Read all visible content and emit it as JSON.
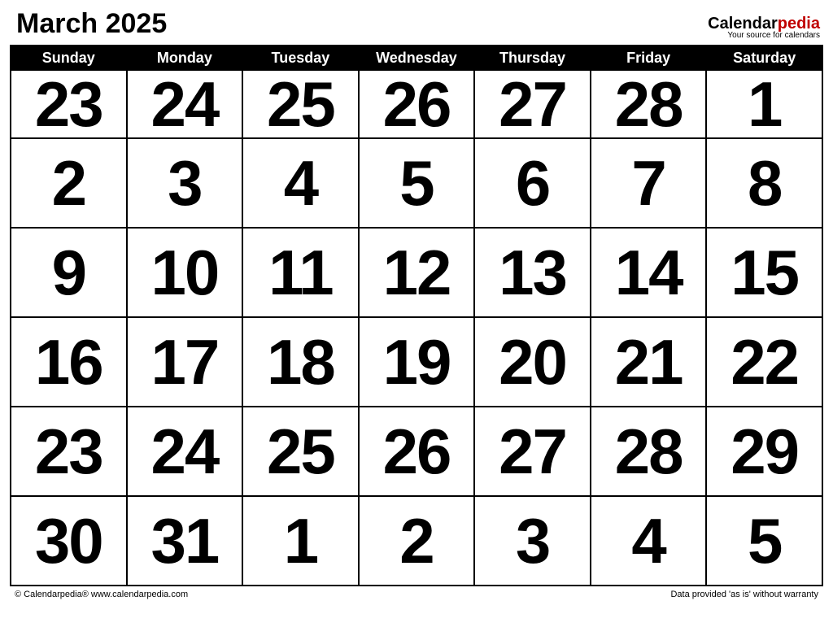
{
  "title": "March 2025",
  "brand": {
    "name_part1": "Calendar",
    "name_part2": "pedia",
    "tagline": "Your source for calendars"
  },
  "days": {
    "sun": "Sunday",
    "mon": "Monday",
    "tue": "Tuesday",
    "wed": "Wednesday",
    "thu": "Thursday",
    "fri": "Friday",
    "sat": "Saturday"
  },
  "weeks": [
    [
      {
        "n": "23",
        "type": "other"
      },
      {
        "n": "24",
        "type": "other"
      },
      {
        "n": "25",
        "type": "other"
      },
      {
        "n": "26",
        "type": "other"
      },
      {
        "n": "27",
        "type": "other"
      },
      {
        "n": "28",
        "type": "other"
      },
      {
        "n": "1",
        "type": "sat"
      }
    ],
    [
      {
        "n": "2",
        "type": "sun"
      },
      {
        "n": "3",
        "type": "wk"
      },
      {
        "n": "4",
        "type": "wk"
      },
      {
        "n": "5",
        "type": "wk"
      },
      {
        "n": "6",
        "type": "wk"
      },
      {
        "n": "7",
        "type": "wk"
      },
      {
        "n": "8",
        "type": "sat"
      }
    ],
    [
      {
        "n": "9",
        "type": "sun"
      },
      {
        "n": "10",
        "type": "wk"
      },
      {
        "n": "11",
        "type": "wk"
      },
      {
        "n": "12",
        "type": "wk"
      },
      {
        "n": "13",
        "type": "wk"
      },
      {
        "n": "14",
        "type": "wk"
      },
      {
        "n": "15",
        "type": "sat"
      }
    ],
    [
      {
        "n": "16",
        "type": "sun"
      },
      {
        "n": "17",
        "type": "wk"
      },
      {
        "n": "18",
        "type": "wk"
      },
      {
        "n": "19",
        "type": "wk"
      },
      {
        "n": "20",
        "type": "wk"
      },
      {
        "n": "21",
        "type": "wk"
      },
      {
        "n": "22",
        "type": "sat"
      }
    ],
    [
      {
        "n": "23",
        "type": "sun"
      },
      {
        "n": "24",
        "type": "wk"
      },
      {
        "n": "25",
        "type": "wk"
      },
      {
        "n": "26",
        "type": "wk"
      },
      {
        "n": "27",
        "type": "wk"
      },
      {
        "n": "28",
        "type": "wk"
      },
      {
        "n": "29",
        "type": "sat"
      }
    ],
    [
      {
        "n": "30",
        "type": "sun"
      },
      {
        "n": "31",
        "type": "wk"
      },
      {
        "n": "1",
        "type": "other"
      },
      {
        "n": "2",
        "type": "other"
      },
      {
        "n": "3",
        "type": "other"
      },
      {
        "n": "4",
        "type": "other"
      },
      {
        "n": "5",
        "type": "other"
      }
    ]
  ],
  "footer": {
    "left": "© Calendarpedia®   www.calendarpedia.com",
    "right": "Data provided 'as is' without warranty"
  }
}
